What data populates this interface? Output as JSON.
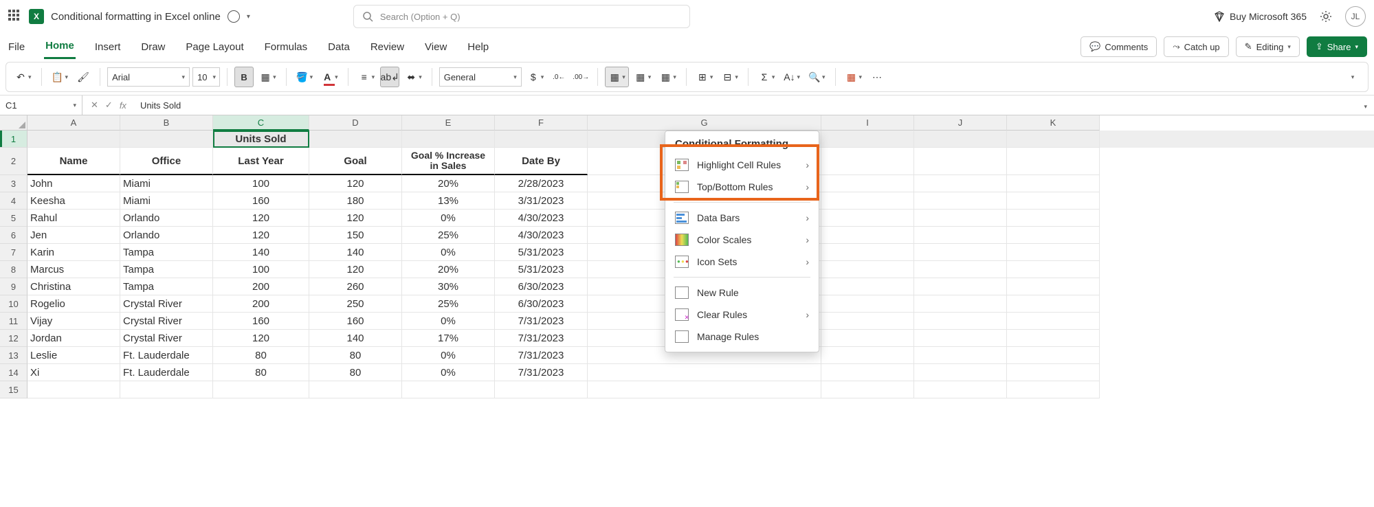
{
  "title": "Conditional formatting in Excel online",
  "search_placeholder": "Search (Option + Q)",
  "buy_text": "Buy Microsoft 365",
  "avatar": "JL",
  "menu": [
    "File",
    "Home",
    "Insert",
    "Draw",
    "Page Layout",
    "Formulas",
    "Data",
    "Review",
    "View",
    "Help"
  ],
  "active_menu": "Home",
  "buttons": {
    "comments": "Comments",
    "catchup": "Catch up",
    "editing": "Editing",
    "share": "Share"
  },
  "ribbon": {
    "font": "Arial",
    "size": "10",
    "number_format": "General",
    "bold": "B",
    "fx": "fx"
  },
  "namebox": "C1",
  "formula": "Units Sold",
  "columns": [
    "A",
    "B",
    "C",
    "D",
    "E",
    "F",
    "G",
    "I",
    "J",
    "K"
  ],
  "active_col": "C",
  "active_row": 1,
  "row_count": 15,
  "c1_value": "Units Sold",
  "headers": {
    "name": "Name",
    "office": "Office",
    "lastyear": "Last Year",
    "goal": "Goal",
    "pct": "Goal % Increase in Sales",
    "date": "Date By"
  },
  "rows": [
    {
      "name": "John",
      "office": "Miami",
      "last": "100",
      "goal": "120",
      "pct": "20%",
      "date": "2/28/2023"
    },
    {
      "name": "Keesha",
      "office": "Miami",
      "last": "160",
      "goal": "180",
      "pct": "13%",
      "date": "3/31/2023"
    },
    {
      "name": "Rahul",
      "office": "Orlando",
      "last": "120",
      "goal": "120",
      "pct": "0%",
      "date": "4/30/2023"
    },
    {
      "name": "Jen",
      "office": "Orlando",
      "last": "120",
      "goal": "150",
      "pct": "25%",
      "date": "4/30/2023"
    },
    {
      "name": "Karin",
      "office": "Tampa",
      "last": "140",
      "goal": "140",
      "pct": "0%",
      "date": "5/31/2023"
    },
    {
      "name": "Marcus",
      "office": "Tampa",
      "last": "100",
      "goal": "120",
      "pct": "20%",
      "date": "5/31/2023"
    },
    {
      "name": "Christina",
      "office": "Tampa",
      "last": "200",
      "goal": "260",
      "pct": "30%",
      "date": "6/30/2023"
    },
    {
      "name": "Rogelio",
      "office": "Crystal River",
      "last": "200",
      "goal": "250",
      "pct": "25%",
      "date": "6/30/2023"
    },
    {
      "name": "Vijay",
      "office": "Crystal River",
      "last": "160",
      "goal": "160",
      "pct": "0%",
      "date": "7/31/2023"
    },
    {
      "name": "Jordan",
      "office": "Crystal River",
      "last": "120",
      "goal": "140",
      "pct": "17%",
      "date": "7/31/2023"
    },
    {
      "name": "Leslie",
      "office": "Ft. Lauderdale",
      "last": "80",
      "goal": "80",
      "pct": "0%",
      "date": "7/31/2023"
    },
    {
      "name": "Xi",
      "office": "Ft. Lauderdale",
      "last": "80",
      "goal": "80",
      "pct": "0%",
      "date": "7/31/2023"
    }
  ],
  "cf_menu": {
    "title": "Conditional Formatting",
    "items1": [
      "Highlight Cell Rules",
      "Top/Bottom Rules"
    ],
    "items2": [
      "Data Bars",
      "Color Scales",
      "Icon Sets"
    ],
    "items3": [
      "New Rule",
      "Clear Rules",
      "Manage Rules"
    ]
  }
}
